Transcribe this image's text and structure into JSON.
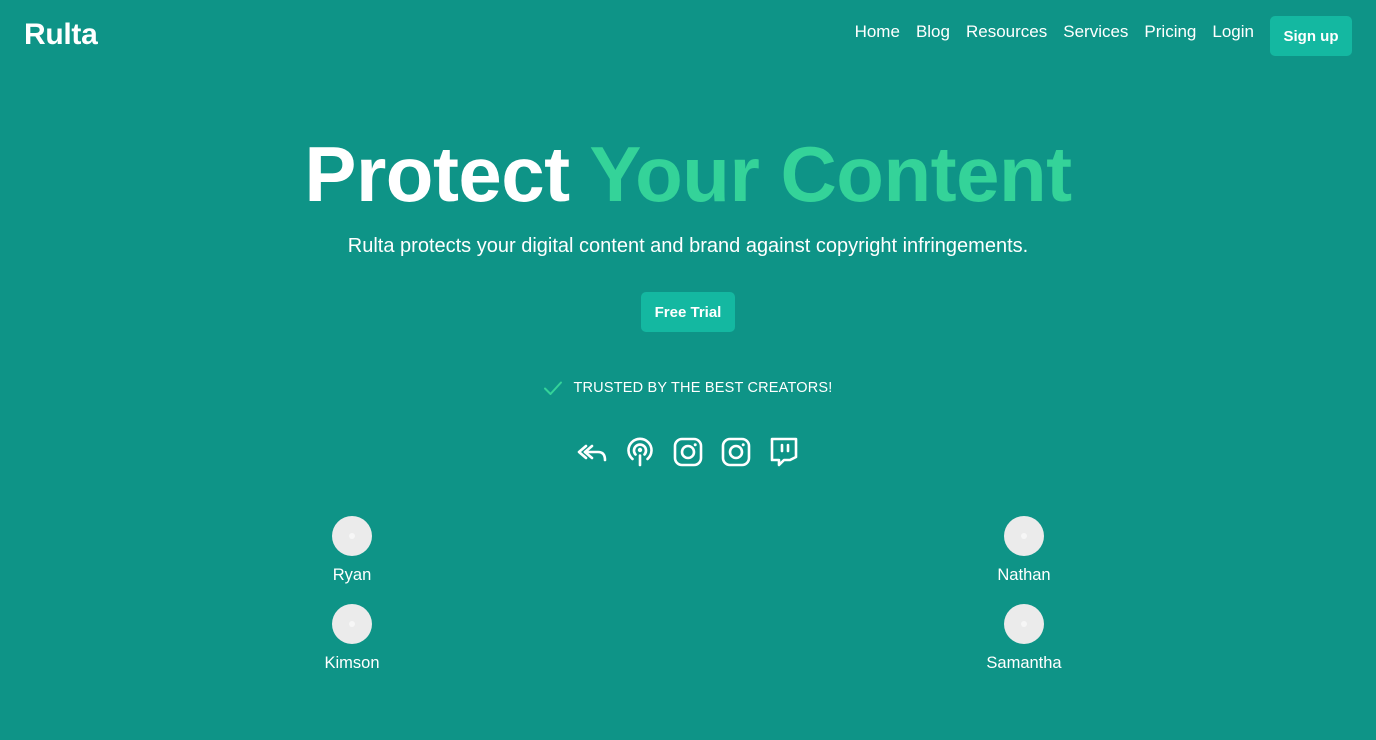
{
  "brand": {
    "name": "Rulta"
  },
  "nav": {
    "links": [
      "Home",
      "Blog",
      "Resources",
      "Services",
      "Pricing",
      "Login"
    ],
    "signup_label": "Sign up"
  },
  "hero": {
    "title_plain": "Protect",
    "title_accent": "Your Content",
    "subtitle": "Rulta protects your digital content and brand against copyright infringements.",
    "cta_label": "Free Trial"
  },
  "trusted": {
    "icon": "check-icon",
    "text": "TRUSTED BY THE BEST CREATORS!"
  },
  "socials": [
    "reply-all-icon",
    "podcast-icon",
    "instagram-icon",
    "instagram-icon",
    "twitch-icon"
  ],
  "creators": {
    "left": [
      "Ryan",
      "Kimson"
    ],
    "right": [
      "Nathan",
      "Samantha"
    ]
  },
  "colors": {
    "background": "#0e9487",
    "accent": "#34d399",
    "button": "#14b8a1"
  }
}
